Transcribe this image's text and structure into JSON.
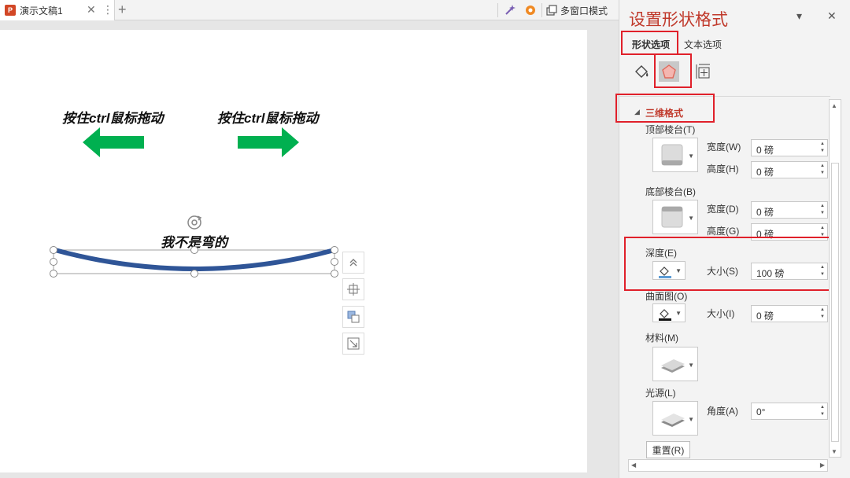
{
  "tabbar": {
    "doc_tab_title": "演示文稿1",
    "close_glyph": "✕",
    "more_glyph": "⋮",
    "add_glyph": "+",
    "multi_window_label": "多窗口模式"
  },
  "slide": {
    "left_text": "按住ctrl鼠标拖动",
    "right_text": "按住ctrl鼠标拖动",
    "curve_text": "我不是弯的",
    "arrow_color": "#00b050",
    "curve_color": "#2f5597"
  },
  "panel": {
    "title": "设置形状格式",
    "collapse_glyph": "▾",
    "close_glyph": "✕",
    "tab_shape": "形状选项",
    "tab_text": "文本选项",
    "section_3d": "三维格式",
    "section_marker": "◢",
    "top_bevel": "顶部棱台(T)",
    "width_w": "宽度(W)",
    "height_h": "高度(H)",
    "top_width": "0 磅",
    "top_height": "0 磅",
    "bottom_bevel": "底部棱台(B)",
    "width_d": "宽度(D)",
    "height_g": "高度(G)",
    "bottom_width": "0 磅",
    "bottom_height": "0 磅",
    "depth": "深度(E)",
    "depth_size_label": "大小(S)",
    "depth_size": "100 磅",
    "contour": "曲面图(O)",
    "contour_size_label": "大小(I)",
    "contour_size": "0 磅",
    "material": "材料(M)",
    "lighting": "光源(L)",
    "angle_label": "角度(A)",
    "angle_value": "0°",
    "reset": "重置(R)",
    "accent_color": "#c0392b",
    "highlight_color": "#e0202a"
  }
}
